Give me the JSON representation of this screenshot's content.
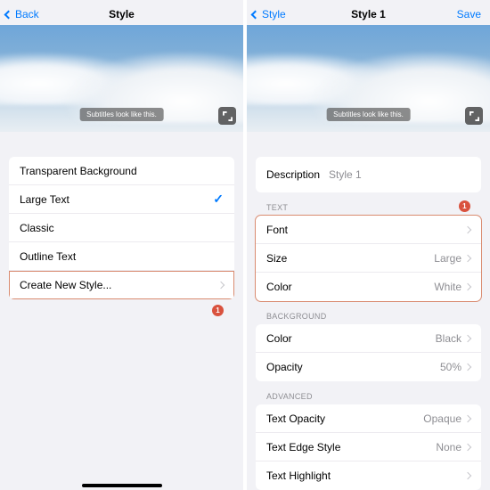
{
  "left": {
    "nav": {
      "back": "Back",
      "title": "Style"
    },
    "preview_subtitle": "Subtitles look like this.",
    "styles": [
      {
        "label": "Transparent Background",
        "selected": false
      },
      {
        "label": "Large Text",
        "selected": true
      },
      {
        "label": "Classic",
        "selected": false
      },
      {
        "label": "Outline Text",
        "selected": false
      }
    ],
    "create_new": "Create New Style...",
    "badge": "1"
  },
  "right": {
    "nav": {
      "back": "Style",
      "title": "Style 1",
      "save": "Save"
    },
    "preview_subtitle": "Subtitles look like this.",
    "description_label": "Description",
    "description_value": "Style 1",
    "sections": {
      "text": {
        "header": "TEXT",
        "badge": "1",
        "rows": [
          {
            "label": "Font",
            "value": ""
          },
          {
            "label": "Size",
            "value": "Large"
          },
          {
            "label": "Color",
            "value": "White"
          }
        ]
      },
      "background": {
        "header": "BACKGROUND",
        "rows": [
          {
            "label": "Color",
            "value": "Black"
          },
          {
            "label": "Opacity",
            "value": "50%"
          }
        ]
      },
      "advanced": {
        "header": "ADVANCED",
        "rows": [
          {
            "label": "Text Opacity",
            "value": "Opaque"
          },
          {
            "label": "Text Edge Style",
            "value": "None"
          },
          {
            "label": "Text Highlight",
            "value": ""
          }
        ]
      }
    }
  }
}
